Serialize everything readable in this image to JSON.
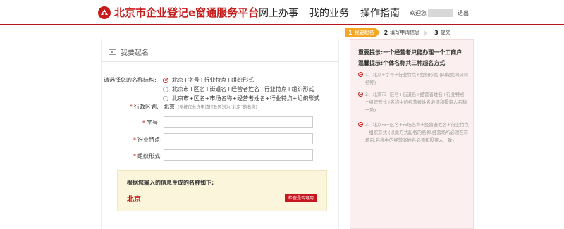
{
  "header": {
    "logo_text": "北京市企业登记e窗通服务平台",
    "nav": [
      "网上办事",
      "我的业务",
      "操作指南"
    ],
    "welcome": "欢迎您",
    "logout": "退出"
  },
  "steps": [
    {
      "num": "1",
      "label": "我要起名",
      "active": true
    },
    {
      "num": "2",
      "label": "填写申请信息",
      "active": false
    },
    {
      "num": "3",
      "label": "提交",
      "active": false
    }
  ],
  "form": {
    "section_title": "我要起名",
    "structure_label": "请选择您的名称结构:",
    "structure_options": [
      {
        "label": "北京+字号+行业特点+组织形式",
        "checked": true
      },
      {
        "label": "北京市+区名+街道名+经营者姓名+行业特点+组织形式",
        "checked": false
      },
      {
        "label": "北京市+区名+市场名称+经营者姓名+行业特点+组织形式",
        "checked": false
      }
    ],
    "region_label": "行政区划:",
    "region_value": "北京",
    "region_note": "(系统仅允许申请行政区划为“北京”的名称)",
    "fields": [
      {
        "label": "字号:",
        "value": "",
        "placeholder": ""
      },
      {
        "label": "行业特点:",
        "value": "",
        "placeholder": ""
      },
      {
        "label": "组织形式:",
        "value": "",
        "placeholder": ""
      }
    ],
    "result_title": "根据您输入的信息生成的名称如下:",
    "result_name": "北京",
    "check_button": "检查是否可用"
  },
  "tips": {
    "line1": "重要提示:一个经营者只能办理一个工商户",
    "line2": "温馨提示:个体名称共三种起名方式",
    "items": [
      "1、北京+字号+行业特点+组织形式 (四段式同公司名称)",
      "2、北京市+区名+街道名+经营者姓名+行业特点+组织形式 (名称中的经营者姓名必须和投资人名称一致)",
      "3、北京市+区名+市场名称+经营者姓名+行业特点+组织形式 (以此方式起名的名称,经营场所必须在市场内,名称中的经营者姓名必须和投资人一致)"
    ]
  },
  "colors": {
    "brand_red": "#c81c1c",
    "step_active": "#f5a623",
    "tips_bg": "#fbefef",
    "result_bg": "#fbf5dc"
  }
}
